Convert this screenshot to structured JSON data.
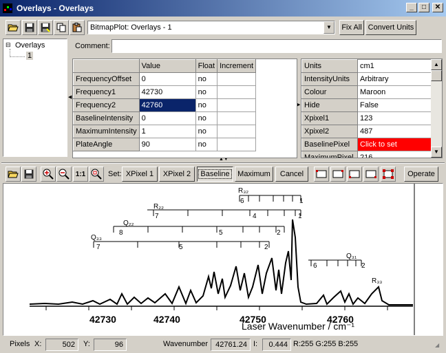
{
  "window": {
    "title": "Overlays - Overlays"
  },
  "toolbar": {
    "plot_select": "BitmapPlot: Overlays - 1",
    "fix_all": "Fix All",
    "convert_units": "Convert Units"
  },
  "tree": {
    "root": "Overlays",
    "child": "1"
  },
  "comment": {
    "label": "Comment:",
    "value": ""
  },
  "overlay_grid": {
    "headers": [
      "",
      "Value",
      "Float",
      "Increment"
    ],
    "rows": [
      {
        "name": "FrequencyOffset",
        "value": "0",
        "float": "no",
        "increment": ""
      },
      {
        "name": "Frequency1",
        "value": "42730",
        "float": "no",
        "increment": ""
      },
      {
        "name": "Frequency2",
        "value": "42760",
        "float": "no",
        "increment": ""
      },
      {
        "name": "BaselineIntensity",
        "value": "0",
        "float": "no",
        "increment": ""
      },
      {
        "name": "MaximumIntensity",
        "value": "1",
        "float": "no",
        "increment": ""
      },
      {
        "name": "PlateAngle",
        "value": "90",
        "float": "no",
        "increment": ""
      }
    ]
  },
  "props_grid": {
    "rows": [
      {
        "name": "Units",
        "value": "cm1"
      },
      {
        "name": "IntensityUnits",
        "value": "Arbitrary"
      },
      {
        "name": "Colour",
        "value": "Maroon"
      },
      {
        "name": "Hide",
        "value": "False"
      },
      {
        "name": "Xpixel1",
        "value": "123"
      },
      {
        "name": "Xpixel2",
        "value": "487"
      },
      {
        "name": "BaselinePixel",
        "value": "Click to set"
      },
      {
        "name": "MaximumPixel",
        "value": "216"
      }
    ]
  },
  "plot_toolbar": {
    "zoom_1to1": "1:1",
    "set_label": "Set:",
    "xpixel1": "XPixel 1",
    "xpixel2": "XPixel 2",
    "baseline": "Baseline",
    "maximum": "Maximum",
    "cancel": "Cancel",
    "operate": "Operate"
  },
  "spectrum": {
    "xlabel": "Laser Wavenumber / cm⁻¹",
    "ticks": [
      "42730",
      "42740",
      "42750",
      "42760"
    ],
    "branches": [
      {
        "label": "R₃₂",
        "left_num": "6",
        "right_num": "1"
      },
      {
        "label": "R₂₂",
        "left_num": "7",
        "mid_num": "4",
        "right_num": "1"
      },
      {
        "label": "Q₂₂",
        "left_num": "8",
        "mid_num": "5",
        "right_num": "2"
      },
      {
        "label": "Q₃₃",
        "left_num": "7",
        "mid_num": "5",
        "right_num": "2"
      },
      {
        "label": "Q₃₁",
        "left_num": "6",
        "right_num": "2"
      },
      {
        "label": "R₃₃"
      }
    ]
  },
  "statusbar": {
    "pixels_label": "Pixels",
    "x_label": "X:",
    "x_value": "502",
    "y_label": "Y:",
    "y_value": "96",
    "wavenumber_label": "Wavenumber",
    "wavenumber_value": "42761.24",
    "i_label": "I:",
    "i_value": "0.444",
    "rgb": "R:255 G:255 B:255"
  }
}
